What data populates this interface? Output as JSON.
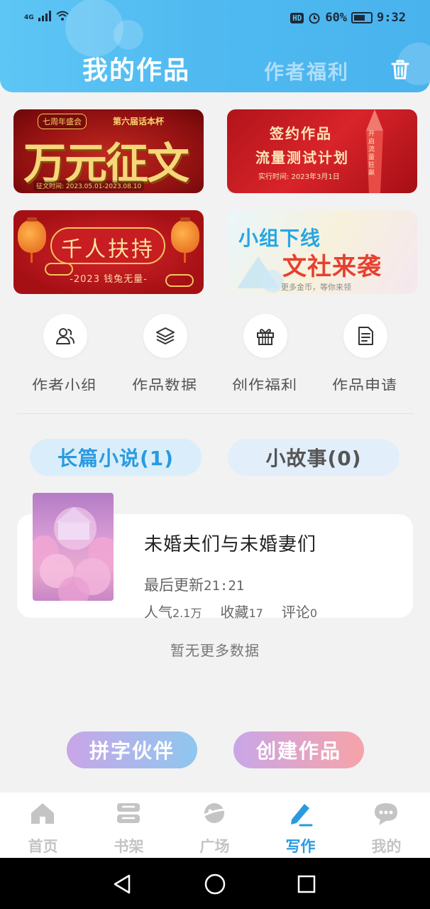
{
  "status_bar": {
    "network": "4G",
    "hd": "HD",
    "battery": "60%",
    "time": "9:32"
  },
  "header": {
    "title": "我的作品",
    "other_tab": "作者福利",
    "delete_icon": "trash-icon"
  },
  "banners": [
    {
      "tag": "七周年盛会",
      "tag2": "第六届话本杯",
      "title": "万元征文",
      "date": "征文时间: 2023.05.01-2023.08.10"
    },
    {
      "line1": "签约作品",
      "line2": "流量测试计划",
      "date": "实行时间: 2023年3月1日",
      "side": "开启流量狂飙"
    },
    {
      "title": "千人扶持",
      "sub": "-2023 钱兔无量-"
    },
    {
      "line1": "小组下线",
      "line2": "文社来袭",
      "sub": "更多金币，等你来领"
    }
  ],
  "actions": [
    {
      "label": "作者小组",
      "icon": "users-icon"
    },
    {
      "label": "作品数据",
      "icon": "layers-icon"
    },
    {
      "label": "创作福利",
      "icon": "gift-icon"
    },
    {
      "label": "作品申请",
      "icon": "document-icon"
    }
  ],
  "segments": {
    "long": "长篇小说(1)",
    "short": "小故事(0)"
  },
  "work": {
    "title": "未婚夫们与未婚妻们",
    "update_label": "最后更新",
    "update_time": "21:21",
    "popularity_label": "人气",
    "popularity": "2.1万",
    "favorites_label": "收藏",
    "favorites": "17",
    "comments_label": "评论",
    "comments": "0"
  },
  "no_more": "暂无更多数据",
  "buttons": {
    "partner": "拼字伙伴",
    "create": "创建作品"
  },
  "tabbar": [
    {
      "label": "首页",
      "icon": "home-icon"
    },
    {
      "label": "书架",
      "icon": "bookshelf-icon"
    },
    {
      "label": "广场",
      "icon": "planet-icon"
    },
    {
      "label": "写作",
      "icon": "pen-icon",
      "active": true
    },
    {
      "label": "我的",
      "icon": "chat-icon"
    }
  ],
  "colors": {
    "accent": "#2a9ae0",
    "header": "#4fb9f0"
  }
}
